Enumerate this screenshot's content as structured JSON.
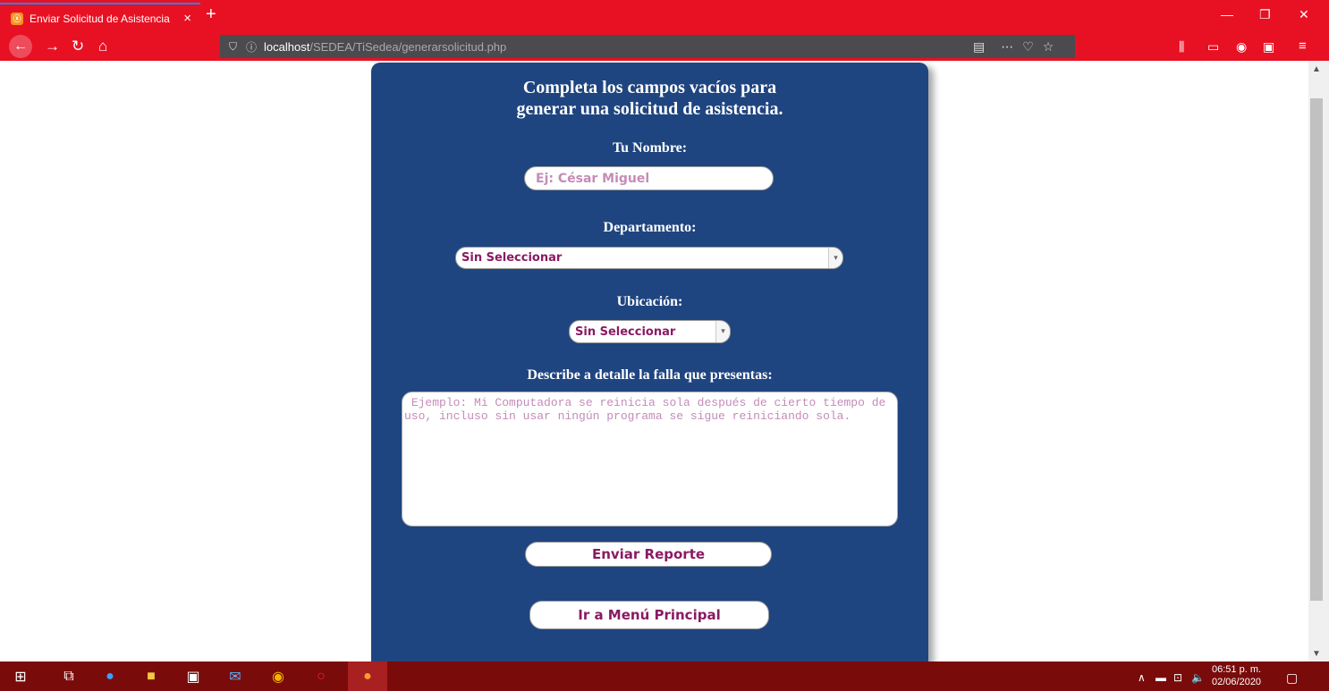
{
  "browser": {
    "tab_title": "Enviar Solicitud de Asistencia",
    "tab_close": "×",
    "new_tab": "+",
    "url_host": "localhost",
    "url_path": "/SEDEA/TiSedea/generarsolicitud.php",
    "win_min": "—",
    "win_max": "❐",
    "win_close": "✕"
  },
  "form": {
    "title_line1": "Completa los campos vacíos para",
    "title_line2": "generar una solicitud de asistencia.",
    "name_label": "Tu Nombre:",
    "name_placeholder": "Ej: César Miguel",
    "department_label": "Departamento:",
    "department_selected": "Sin Seleccionar",
    "location_label": "Ubicación:",
    "location_selected": "Sin Seleccionar",
    "description_label": "Describe a detalle la falla que presentas:",
    "description_placeholder": " Ejemplo: Mi Computadora se reinicia sola después de cierto tiempo de uso, incluso sin usar ningún programa se sigue reiniciando sola.",
    "submit_label": "Enviar Reporte",
    "menu_label": "Ir a Menú Principal"
  },
  "taskbar": {
    "time": "06:51 p. m.",
    "date": "02/06/2020"
  },
  "colors": {
    "browser_red": "#e81123",
    "panel_blue": "#1f4580",
    "button_text": "#8a1a63",
    "placeholder": "#c48cb8"
  }
}
